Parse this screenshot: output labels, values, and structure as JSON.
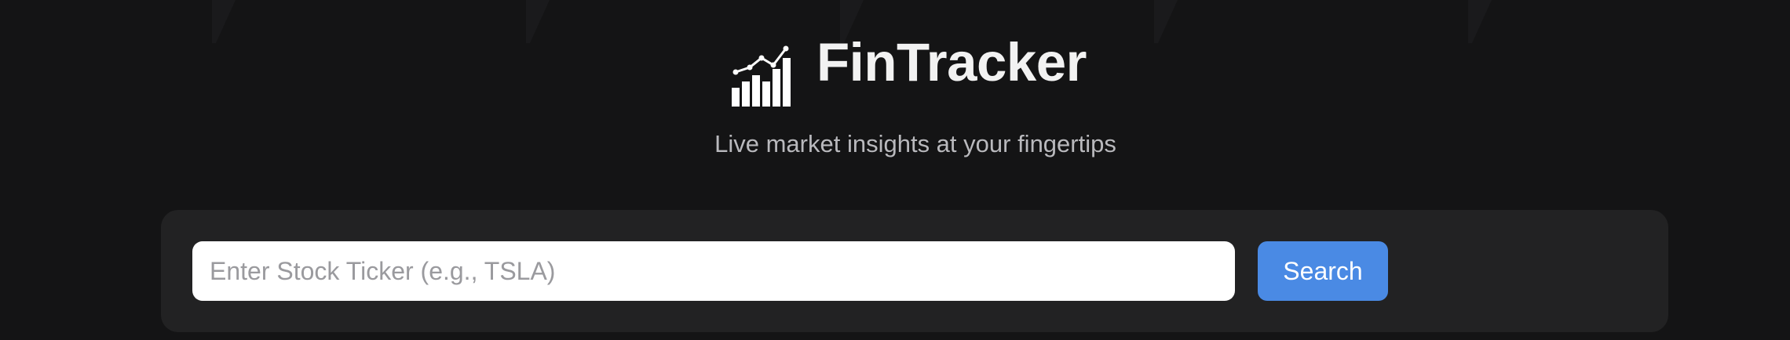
{
  "app": {
    "title": "FinTracker",
    "tagline": "Live market insights at your fingertips",
    "logo_icon": "chart-growth-icon"
  },
  "search": {
    "placeholder": "Enter Stock Ticker (e.g., TSLA)",
    "value": "",
    "button_label": "Search"
  },
  "colors": {
    "background": "#141415",
    "panel": "#222223",
    "accent": "#4a8ae4",
    "title": "#f2f2f2",
    "tagline": "#b9b9bd"
  }
}
